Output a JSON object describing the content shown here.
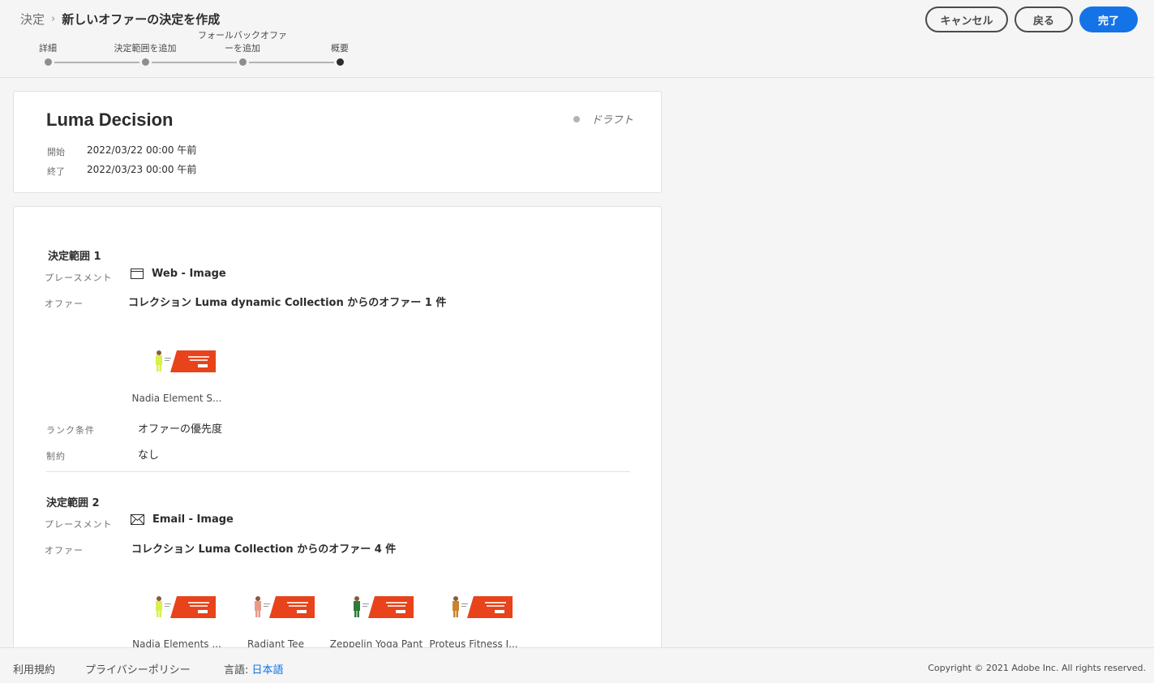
{
  "header": {
    "breadcrumb_parent": "決定",
    "breadcrumb_current": "新しいオファーの決定を作成",
    "cancel_label": "キャンセル",
    "back_label": "戻る",
    "done_label": "完了",
    "accent_color": "#1473e6"
  },
  "steps": [
    {
      "label": "詳細",
      "label2": ""
    },
    {
      "label": "決定範囲を追加",
      "label2": ""
    },
    {
      "label": "フォールバックオファ",
      "label2": "ーを追加"
    },
    {
      "label": "概要",
      "label2": ""
    }
  ],
  "summary": {
    "title": "Luma Decision",
    "status": "ドラフト",
    "start_label": "開始",
    "start_value": "2022/03/22 00:00 午前",
    "end_label": "終了",
    "end_value": "2022/03/23 00:00 午前"
  },
  "scopes": [
    {
      "title": "決定範囲 1",
      "placement_label": "プレースメント",
      "placement_value": "Web - Image",
      "placement_icon": "browser-window-icon",
      "offer_label": "オファー",
      "offer_value": "コレクション Luma dynamic Collection からのオファー 1 件",
      "offers": [
        {
          "name": "Nadia Element S...",
          "figure_color": "#d8f04a"
        }
      ],
      "rank_label": "ランク条件",
      "rank_value": "オファーの優先度",
      "constraint_label": "制約",
      "constraint_value": "なし"
    },
    {
      "title": "決定範囲 2",
      "placement_label": "プレースメント",
      "placement_value": "Email - Image",
      "placement_icon": "envelope-icon",
      "offer_label": "オファー",
      "offer_value": "コレクション Luma Collection からのオファー 4 件",
      "offers": [
        {
          "name": "Nadia Elements ...",
          "figure_color": "#d8f04a"
        },
        {
          "name": "Radiant Tee",
          "figure_color": "#e89a8a"
        },
        {
          "name": "Zeppelin Yoga Pant",
          "figure_color": "#2e7a3a"
        },
        {
          "name": "Proteus Fitness J...",
          "figure_color": "#c9842a"
        }
      ]
    }
  ],
  "footer": {
    "terms": "利用規約",
    "privacy": "プライバシーポリシー",
    "language_label": "言語:",
    "language_value": "日本語",
    "copyright": "Copyright ©  2021 Adobe Inc.  All rights reserved."
  }
}
